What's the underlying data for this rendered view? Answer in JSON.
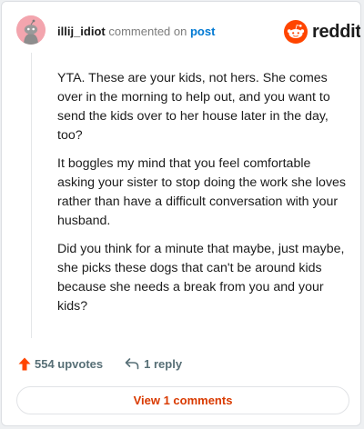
{
  "header": {
    "username": "illij_idiot",
    "action_text": "commented on",
    "post_link": "post",
    "logo_word": "reddit"
  },
  "comment": {
    "paragraphs": [
      "YTA. These are your kids, not hers. She comes over in the morning to help out, and you want to send the kids over to her house later in the day, too?",
      "It boggles my mind that you feel comfortable asking your sister to stop doing the work she loves rather than have a difficult conversation with your husband.",
      "Did you think for a minute that maybe, just maybe, she picks these dogs that can't be around kids because she needs a break from you and your kids?"
    ]
  },
  "actions": {
    "upvotes": "554 upvotes",
    "replies": "1 reply"
  },
  "footer": {
    "view_comments": "View 1 comments"
  },
  "icons": {
    "avatar": "snoo-avatar-icon",
    "logo": "reddit-snoo-icon",
    "upvote": "upvote-arrow-icon",
    "reply": "reply-arrow-icon"
  },
  "colors": {
    "accent": "#ff4500",
    "link": "#0079d3",
    "view_button_text": "#d93a00",
    "avatar_bg": "#f3a5ae"
  }
}
